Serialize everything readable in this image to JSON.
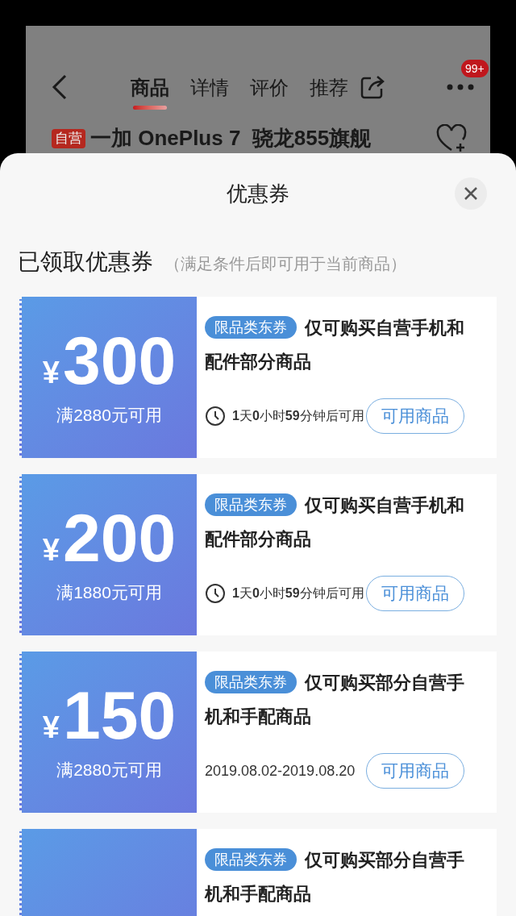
{
  "background_page": {
    "tabs": [
      {
        "label": "商品",
        "selected": true
      },
      {
        "label": "详情",
        "selected": false
      },
      {
        "label": "评价",
        "selected": false
      },
      {
        "label": "推荐",
        "selected": false
      }
    ],
    "badge": "99+",
    "product": {
      "tag": "自营",
      "title": "一加 OnePlus 7  骁龙855旗舰"
    }
  },
  "sheet": {
    "title": "优惠券",
    "section": {
      "title": "已领取优惠券",
      "note": "（满足条件后即可用于当前商品）"
    },
    "coupons": [
      {
        "currency": "¥",
        "amount": "300",
        "condition": "满2880元可用",
        "tag": "限品类东券",
        "description": "仅可购买自营手机和配件部分商品",
        "validity": {
          "kind": "countdown",
          "text": "**1**天**0**小时**59**分钟后可用"
        },
        "button": "可用商品"
      },
      {
        "currency": "¥",
        "amount": "200",
        "condition": "满1880元可用",
        "tag": "限品类东券",
        "description": "仅可购买自营手机和配件部分商品",
        "validity": {
          "kind": "countdown",
          "text": "**1**天**0**小时**59**分钟后可用"
        },
        "button": "可用商品"
      },
      {
        "currency": "¥",
        "amount": "150",
        "condition": "满2880元可用",
        "tag": "限品类东券",
        "description": "仅可购买部分自营手机和手配商品",
        "validity": {
          "kind": "date",
          "text": "2019.08.02-2019.08.20"
        },
        "button": "可用商品"
      },
      {
        "tag": "限品类东券",
        "description": "仅可购买部分自营手机和手配商品"
      }
    ]
  }
}
